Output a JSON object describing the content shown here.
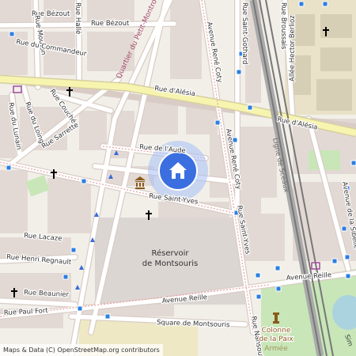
{
  "streets": {
    "rue_bezout_1": "Rue Bézout",
    "rue_bezout_2": "Rue Bézout",
    "rue_halle": "Rue Hallé",
    "rue_mouton": "Rue Mouton",
    "rue_commandeur": "Rue du Commandeur",
    "rue_alesia_1": "Rue d'Alésia",
    "rue_alesia_2": "Rue d'Alésia",
    "rue_couche": "Rue Couché",
    "rue_du_loing": "Rue du Loing",
    "rue_du_lunain": "Rue du Lunain",
    "rue_sarrette": "Rue Sarrette",
    "rue_aude": "Rue de l'Aude",
    "rue_saint_yves": "Rue Saint-Yves",
    "rue_lacaze": "Rue Lacaze",
    "rue_henri_regnault": "Rue Henri Regnault",
    "rue_beaunier": "Rue Beaunier",
    "rue_paul_fort": "Rue Paul Fort",
    "avenue_reille_1": "Avenue Reille",
    "avenue_reille_2": "Avenue Reille",
    "square_montsouris": "Square de Montsouris",
    "avenue_rene_coty_1": "Avenue René Coty",
    "avenue_rene_coty_2": "Avenue René Coty",
    "rue_saint_yves_east": "Rue Saint-Yves",
    "rue_saint_gothard": "Rue Saint-Gothard",
    "rue_broussais": "Rue Broussais",
    "allee_hector_berlioz": "Allée Hector Berlioz",
    "avenue_sibelle": "Avenue de la Sibelle",
    "rue_nansouty": "Rue Nansouty",
    "ligne_sceaux": "Ligne de Sceaux"
  },
  "areas": {
    "quartier": "Quartier du Petit-Montrouge",
    "reservoir_line1": "Réservoir",
    "reservoir_line2": "de Montsouris",
    "colonne_line1": "Colonne",
    "colonne_line2": "de la Paix",
    "armee": "Armée",
    "truncated_sim": "Sim"
  },
  "location_marker": {
    "icon": "home-icon"
  },
  "attribution": "Maps & Data (C) OpenStreetMap.org contributors",
  "colors": {
    "background": "#f2efe9",
    "block": "#e2d8d3",
    "street": "#ffffff",
    "street_casing": "#d9ccc6",
    "major_road": "#f7f4b0",
    "park": "#c8e6b8",
    "reservoir": "#d9d3d0",
    "bus_stop": "#2b7fe0",
    "marker": "#3b6fe0",
    "marker_halo": "#a6c0f5"
  }
}
